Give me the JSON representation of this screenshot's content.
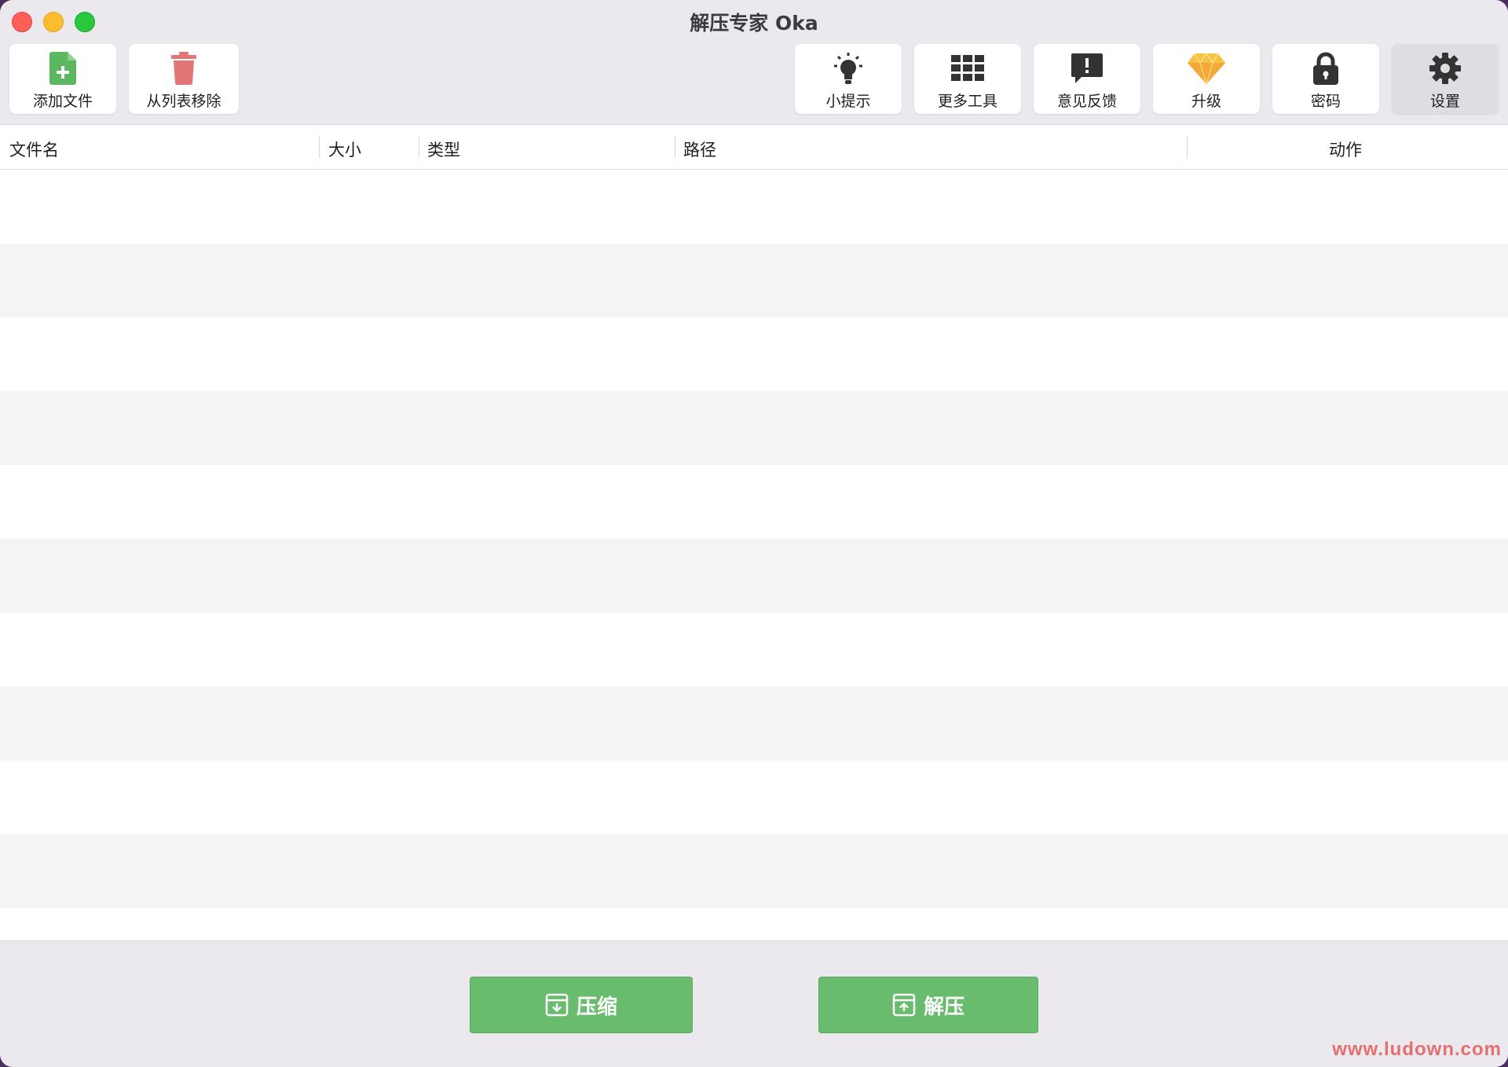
{
  "window": {
    "title": "解压专家 Oka"
  },
  "toolbar": {
    "left": [
      {
        "label": "添加文件",
        "icon": "add-file-icon"
      },
      {
        "label": "从列表移除",
        "icon": "trash-icon"
      }
    ],
    "right": [
      {
        "label": "小提示",
        "icon": "lightbulb-icon"
      },
      {
        "label": "更多工具",
        "icon": "grid-icon"
      },
      {
        "label": "意见反馈",
        "icon": "feedback-icon"
      },
      {
        "label": "升级",
        "icon": "diamond-icon"
      },
      {
        "label": "密码",
        "icon": "lock-icon"
      },
      {
        "label": "设置",
        "icon": "gear-icon",
        "active": true
      }
    ]
  },
  "table": {
    "columns": [
      "文件名",
      "大小",
      "类型",
      "路径",
      "动作"
    ],
    "rows": []
  },
  "actions": {
    "compress_label": "压缩",
    "extract_label": "解压"
  },
  "watermark": "www.ludown.com",
  "colors": {
    "accent_green": "#69bb6d",
    "add_icon_green": "#5cb860",
    "trash_red": "#e27576",
    "diamond_gold": "#f6c244"
  }
}
